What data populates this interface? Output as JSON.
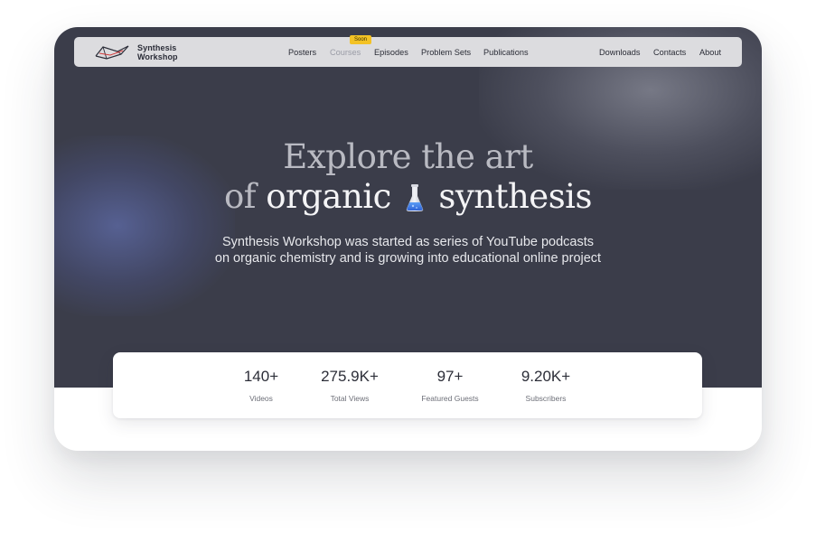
{
  "brand": {
    "line1": "Synthesis",
    "line2": "Workshop",
    "icon": "synthesis-workshop-logo"
  },
  "nav": {
    "left": [
      {
        "label": "Posters"
      },
      {
        "label": "Courses",
        "badge": "Soon",
        "disabled": true
      },
      {
        "label": "Episodes"
      },
      {
        "label": "Problem Sets"
      },
      {
        "label": "Publications"
      }
    ],
    "right": [
      {
        "label": "Downloads"
      },
      {
        "label": "Contacts"
      },
      {
        "label": "About"
      }
    ]
  },
  "hero": {
    "line1": "Explore the art",
    "line2_prefix": "of",
    "line2_word1": "organic",
    "line2_icon": "flask-icon",
    "line2_word2": "synthesis",
    "subtitle_line1": "Synthesis Workshop was started as series of YouTube podcasts",
    "subtitle_line2": "on organic chemistry and is growing into educational online project"
  },
  "stats": [
    {
      "value": "140+",
      "label": "Videos"
    },
    {
      "value": "275.9K+",
      "label": "Total Views"
    },
    {
      "value": "97+",
      "label": "Featured Guests"
    },
    {
      "value": "9.20K+",
      "label": "Subscribers"
    }
  ],
  "colors": {
    "hero_background": "#3b3d4a",
    "navbar_background": "#dcdcdf",
    "badge_yellow": "#f3c225",
    "flask_blue": "#3a7be8"
  }
}
